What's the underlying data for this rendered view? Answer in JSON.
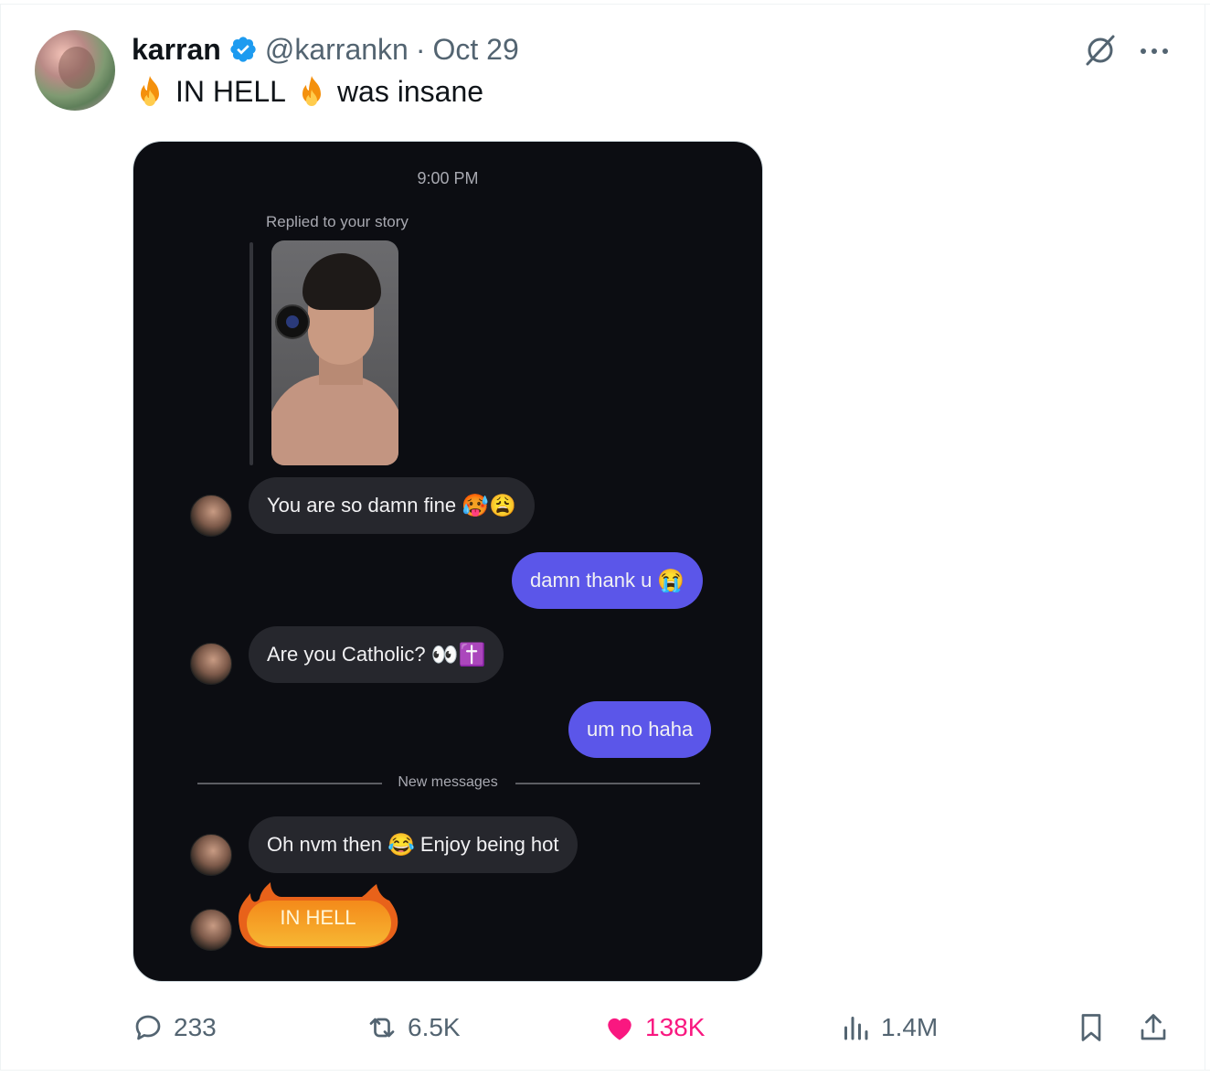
{
  "tweet": {
    "display_name": "karran",
    "handle": "@karrankn",
    "separator": "·",
    "date": "Oct 29",
    "text_part1": "IN HELL",
    "text_part2": "was insane"
  },
  "dm": {
    "time": "9:00 PM",
    "replied_label": "Replied to your story",
    "messages": [
      {
        "side": "in",
        "text": "You are so damn fine",
        "emoji": "🥵😩"
      },
      {
        "side": "out",
        "text": "damn thank u",
        "emoji": "😭"
      },
      {
        "side": "in",
        "text": "Are you Catholic?",
        "emoji": "👀✝️"
      },
      {
        "side": "out",
        "text": "um no haha",
        "emoji": ""
      },
      {
        "side": "in",
        "text": "Oh nvm then",
        "emoji": "😂",
        "text_after": "Enjoy being hot"
      }
    ],
    "new_messages_label": "New messages",
    "flame_text": "IN HELL"
  },
  "actions": {
    "replies": "233",
    "reposts": "6.5K",
    "likes": "138K",
    "views": "1.4M"
  },
  "colors": {
    "accent_blue": "#1d9bf0",
    "like_pink": "#f91880",
    "outgoing_bubble": "#5b56e9",
    "incoming_bubble": "#26272d"
  },
  "icons": [
    "verified-badge-icon",
    "fire-icon",
    "grok-icon",
    "more-icon",
    "reply-icon",
    "repost-icon",
    "heart-icon",
    "views-icon",
    "bookmark-icon",
    "share-icon"
  ]
}
